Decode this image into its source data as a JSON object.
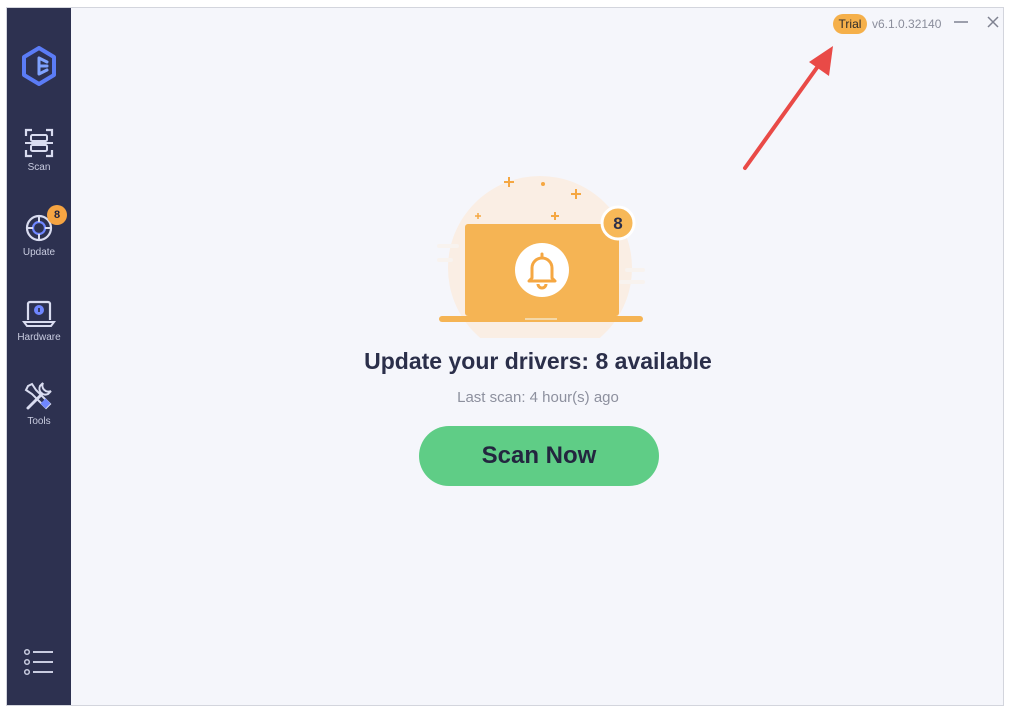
{
  "sidebar": {
    "items": [
      {
        "label": "Scan",
        "icon": "scan-icon"
      },
      {
        "label": "Update",
        "icon": "update-icon",
        "badge": "8"
      },
      {
        "label": "Hardware",
        "icon": "hardware-icon"
      },
      {
        "label": "Tools",
        "icon": "tools-icon"
      }
    ],
    "menu_icon": "menu-list-icon"
  },
  "titlebar": {
    "trial_label": "Trial",
    "version": "v6.1.0.32140"
  },
  "main": {
    "badge_count": "8",
    "headline": "Update your drivers: 8 available",
    "last_scan": "Last scan: 4 hour(s) ago",
    "scan_button": "Scan Now"
  },
  "colors": {
    "sidebar": "#2d3150",
    "accent_orange": "#f6a442",
    "scan_green": "#5fcd86",
    "annotation_red": "#e94a47"
  }
}
